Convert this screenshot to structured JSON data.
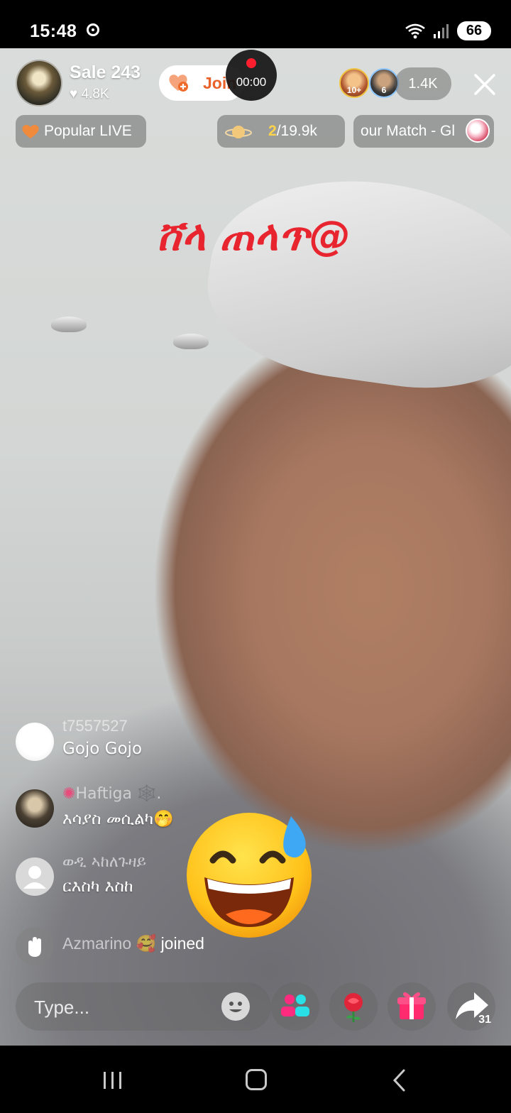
{
  "status_bar": {
    "time": "15:48",
    "battery": "66"
  },
  "host": {
    "name": "Sale 243",
    "likes": "4.8K",
    "join_label": "Join"
  },
  "recording": {
    "time": "00:00"
  },
  "viewers": {
    "badges": [
      "10+",
      "6"
    ],
    "count": "1.4K"
  },
  "chips": {
    "popular": "Popular LIVE",
    "planet_current": "2",
    "planet_total": "/19.9k",
    "match": "our Match - Gl"
  },
  "overlay_text": "ሸላ ጠላጥ@",
  "comments": [
    {
      "user": "t7557527",
      "message": "Gojo Gojo"
    },
    {
      "user": "Haftiga 🕸️.",
      "message": "እሳያስ መሲልካ🤭"
    },
    {
      "user": "ወዲ ኣከለጉዛይ",
      "message": "ርእስካ እስከ"
    }
  ],
  "join_event": {
    "user": "Azmarino 🥰",
    "verb": "joined"
  },
  "big_emoji": "grinning-face-with-sweat",
  "input": {
    "placeholder": "Type..."
  },
  "share_count": "31",
  "colors": {
    "accent_red": "#e8242f",
    "join_orange": "#e8622a",
    "gold": "#ffd44a"
  }
}
